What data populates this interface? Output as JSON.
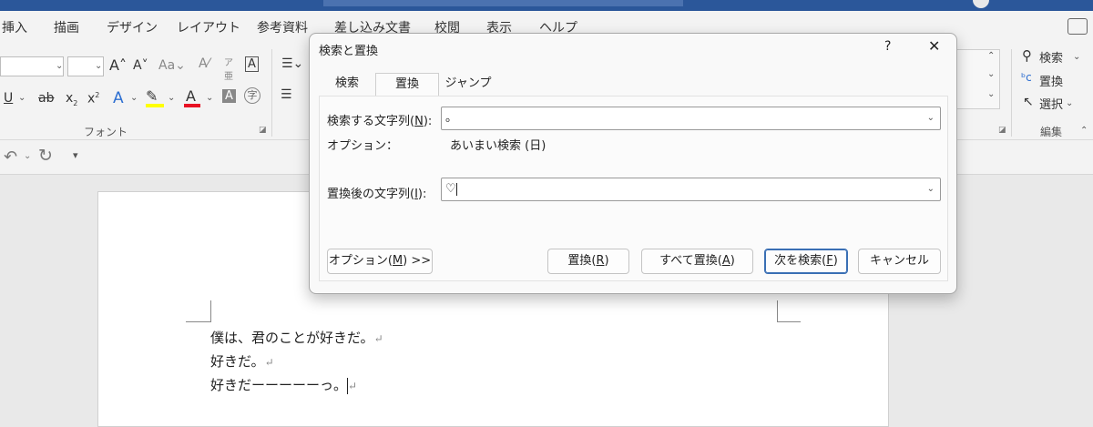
{
  "menu": {
    "items": [
      "挿入",
      "描画",
      "デザイン",
      "レイアウト",
      "参考資料",
      "差し込み文書",
      "校閲",
      "表示",
      "ヘルプ"
    ]
  },
  "ribbon": {
    "font_group_label": "フォント",
    "editing_group_label": "編集",
    "find_label": "検索",
    "replace_label": "置換",
    "select_label": "選択"
  },
  "document": {
    "lines": [
      "僕は、君のことが好きだ。",
      "好きだ。",
      "好きだーーーーーっ。"
    ],
    "paragraph_mark": "↵"
  },
  "dialog": {
    "title": "検索と置換",
    "help": "?",
    "tabs": [
      "検索",
      "置換",
      "ジャンプ"
    ],
    "active_tab": "置換",
    "find_label": "検索する文字列(",
    "find_access": "N",
    "find_value": "。",
    "options_label": "オプション：",
    "options_value": "あいまい検索 (日)",
    "replace_label": "置換後の文字列(",
    "replace_access": "I",
    "replace_value": "♡",
    "buttons": {
      "options": "オプション(",
      "options_access": "M",
      "options_tail": ") >>",
      "replace": "置換(",
      "replace_access": "R",
      "replace_all": "すべて置換(",
      "replace_all_access": "A",
      "find_next": "次を検索(",
      "find_next_access": "F",
      "cancel": "キャンセル"
    }
  },
  "icons": [
    "undo-icon",
    "redo-icon",
    "close-icon",
    "search-icon",
    "replace-icon",
    "select-icon",
    "chevron-down-icon"
  ],
  "colors": {
    "accent": "#2b579a",
    "highlight": "#ffff00",
    "font_color": "#e81123"
  }
}
